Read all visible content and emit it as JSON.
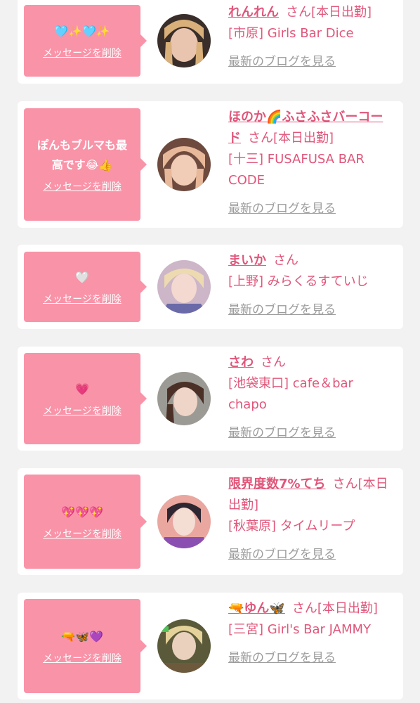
{
  "delete_label": "メッセージを削除",
  "blog_label": "最新のブログを見る",
  "san": "さん",
  "colors": {
    "bubble": "#f993a8",
    "accent": "#e0567a",
    "muted": "#9c9c9c",
    "page_bg": "#f2f2f2"
  },
  "cards": [
    {
      "message": "🩵✨🩵✨",
      "name": "れんれん",
      "status": "[本日出勤]",
      "shop": "[市原] Girls Bar Dice"
    },
    {
      "message": "ぽんもブルマも最高です😂👍",
      "name": "ほのか🌈ふさふさバーコード",
      "status": "[本日出勤]",
      "shop": "[十三] FUSAFUSA BAR CODE"
    },
    {
      "message": "🤍",
      "name": "まいか",
      "status": "",
      "shop": "[上野] みらくるすていじ"
    },
    {
      "message": "💗",
      "name": "さわ",
      "status": "",
      "shop": "[池袋東口] cafe＆bar chapo"
    },
    {
      "message": "💖💖💖",
      "name": "限界度数7%てち",
      "status": "[本日出勤]",
      "shop": "[秋葉原] タイムリープ"
    },
    {
      "message": "🔫🦋💜",
      "name": "🔫ゆん🦋",
      "status": "[本日出勤]",
      "shop": "[三宮] Girl's Bar JAMMY"
    }
  ]
}
